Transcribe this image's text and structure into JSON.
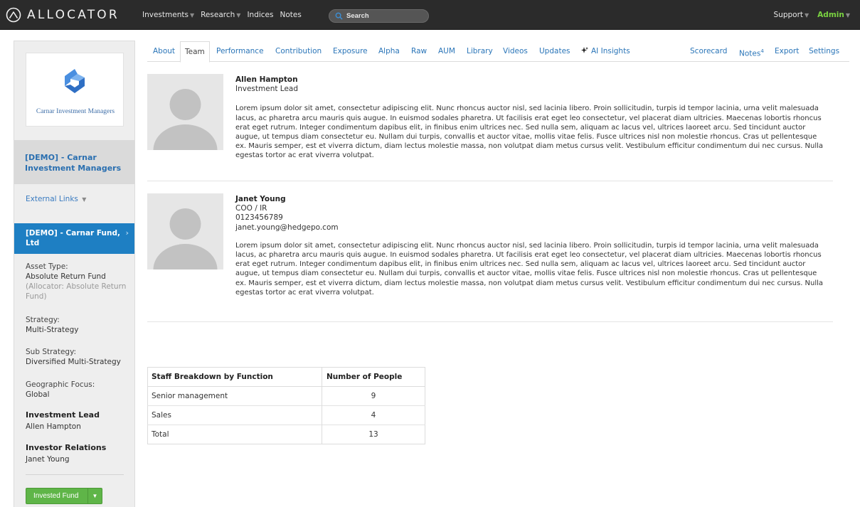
{
  "brand": {
    "name": "ALLOCATOR"
  },
  "nav": {
    "items": [
      "Investments",
      "Research",
      "Indices",
      "Notes"
    ],
    "search_placeholder": "Search",
    "support": "Support",
    "admin": "Admin"
  },
  "sidebar": {
    "logo_text": "Carnar Investment Managers",
    "manager": "[DEMO] - Carnar Investment Managers",
    "external_links": "External Links",
    "fund": "[DEMO] - Carnar Fund, Ltd",
    "asset_type_label": "Asset Type:",
    "asset_type_value": "Absolute Return Fund",
    "asset_type_sub": "(Allocator: Absolute Return Fund)",
    "strategy_label": "Strategy:",
    "strategy_value": "Multi-Strategy",
    "sub_strategy_label": "Sub Strategy:",
    "sub_strategy_value": "Diversified Multi-Strategy",
    "geo_label": "Geographic Focus:",
    "geo_value": "Global",
    "inv_lead_label": "Investment Lead",
    "inv_lead_value": "Allen Hampton",
    "ir_label": "Investor Relations",
    "ir_value": "Janet Young",
    "invested_button": "Invested Fund"
  },
  "tabs": {
    "about": "About",
    "team": "Team",
    "performance": "Performance",
    "contribution": "Contribution",
    "exposure": "Exposure",
    "alpha": "Alpha",
    "raw": "Raw",
    "aum": "AUM",
    "library": "Library",
    "videos": "Videos",
    "updates": "Updates",
    "ai": "AI Insights",
    "scorecard": "Scorecard",
    "notes": "Notes",
    "notes_count": "4",
    "export": "Export",
    "settings": "Settings",
    "active": "Team"
  },
  "team": [
    {
      "name": "Allen Hampton",
      "title": "Investment Lead",
      "phone": "",
      "email": "",
      "bio": "Lorem ipsum dolor sit amet, consectetur adipiscing elit. Nunc rhoncus auctor nisl, sed lacinia libero. Proin sollicitudin, turpis id tempor lacinia, urna velit malesuada lacus, ac pharetra arcu mauris quis augue. In euismod sodales pharetra. Ut facilisis erat eget leo consectetur, vel placerat diam ultricies. Maecenas lobortis rhoncus erat eget rutrum. Integer condimentum dapibus elit, in finibus enim ultrices nec. Sed nulla sem, aliquam ac lacus vel, ultrices laoreet arcu. Sed tincidunt auctor augue, ut tempus diam consectetur eu. Nullam dui turpis, convallis et auctor vitae, mollis vitae felis. Fusce ultrices nisl non molestie rhoncus. Cras ut pellentesque ex. Mauris semper, est et viverra dictum, diam lectus molestie massa, non volutpat diam metus cursus velit. Vestibulum efficitur condimentum dui nec cursus. Nulla egestas tortor ac erat viverra volutpat."
    },
    {
      "name": "Janet Young",
      "title": "COO / IR",
      "phone": "0123456789",
      "email": "janet.young@hedgepo.com",
      "bio": "Lorem ipsum dolor sit amet, consectetur adipiscing elit. Nunc rhoncus auctor nisl, sed lacinia libero. Proin sollicitudin, turpis id tempor lacinia, urna velit malesuada lacus, ac pharetra arcu mauris quis augue. In euismod sodales pharetra. Ut facilisis erat eget leo consectetur, vel placerat diam ultricies. Maecenas lobortis rhoncus erat eget rutrum. Integer condimentum dapibus elit, in finibus enim ultrices nec. Sed nulla sem, aliquam ac lacus vel, ultrices laoreet arcu. Sed tincidunt auctor augue, ut tempus diam consectetur eu. Nullam dui turpis, convallis et auctor vitae, mollis vitae felis. Fusce ultrices nisl non molestie rhoncus. Cras ut pellentesque ex. Mauris semper, est et viverra dictum, diam lectus molestie massa, non volutpat diam metus cursus velit. Vestibulum efficitur condimentum dui nec cursus. Nulla egestas tortor ac erat viverra volutpat."
    }
  ],
  "staff_table": {
    "headers": [
      "Staff Breakdown by Function",
      "Number of People"
    ],
    "rows": [
      [
        "Senior management",
        "9"
      ],
      [
        "Sales",
        "4"
      ],
      [
        "Total",
        "13"
      ]
    ]
  },
  "colors": {
    "navbar": "#2b2b2b",
    "link": "#2a75b8",
    "active_fund": "#1e7fc3",
    "admin": "#7ad341",
    "button_green": "#5fb548"
  },
  "icons": {
    "brand": "allocator-logo-icon",
    "search": "search-icon",
    "ai": "sparkle-icon",
    "avatar": "user-silhouette-icon"
  }
}
